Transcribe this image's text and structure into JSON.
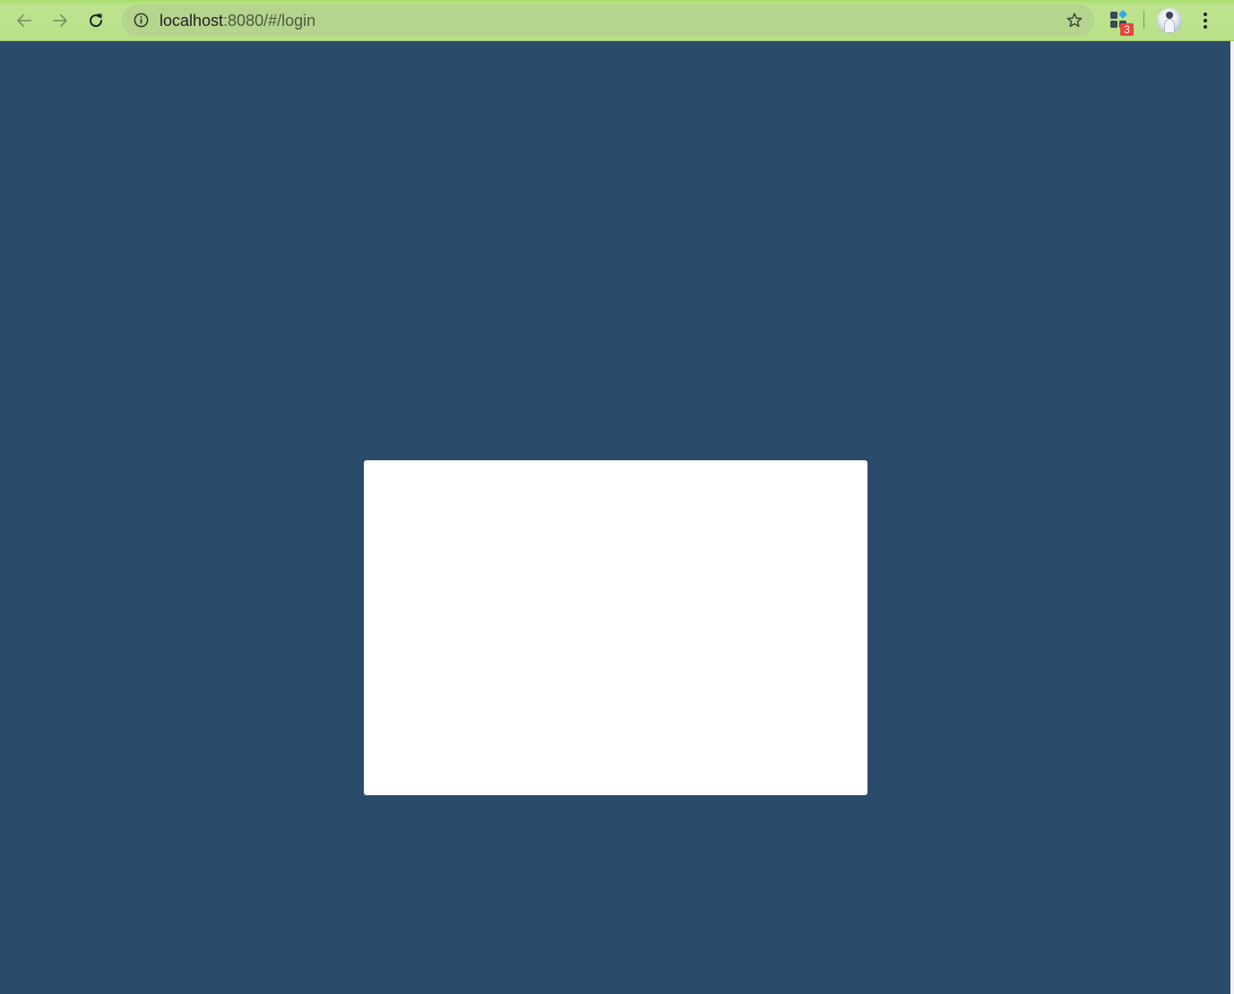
{
  "browser": {
    "address_bar": {
      "host": "localhost",
      "rest": ":8080/#/login"
    },
    "extension_badge": "3",
    "colors": {
      "toolbar": "#b9e089",
      "page_background": "#2b4b6b",
      "login_box": "#ffffff",
      "badge": "#e8453c"
    },
    "icons": {
      "back": "arrow-left-icon",
      "forward": "arrow-right-icon",
      "reload": "reload-icon",
      "site_info": "info-icon",
      "bookmark": "star-icon",
      "extensions": "extensions-icon",
      "profile": "avatar",
      "menu": "kebab-menu-icon"
    }
  },
  "page": {
    "login_box": {}
  }
}
